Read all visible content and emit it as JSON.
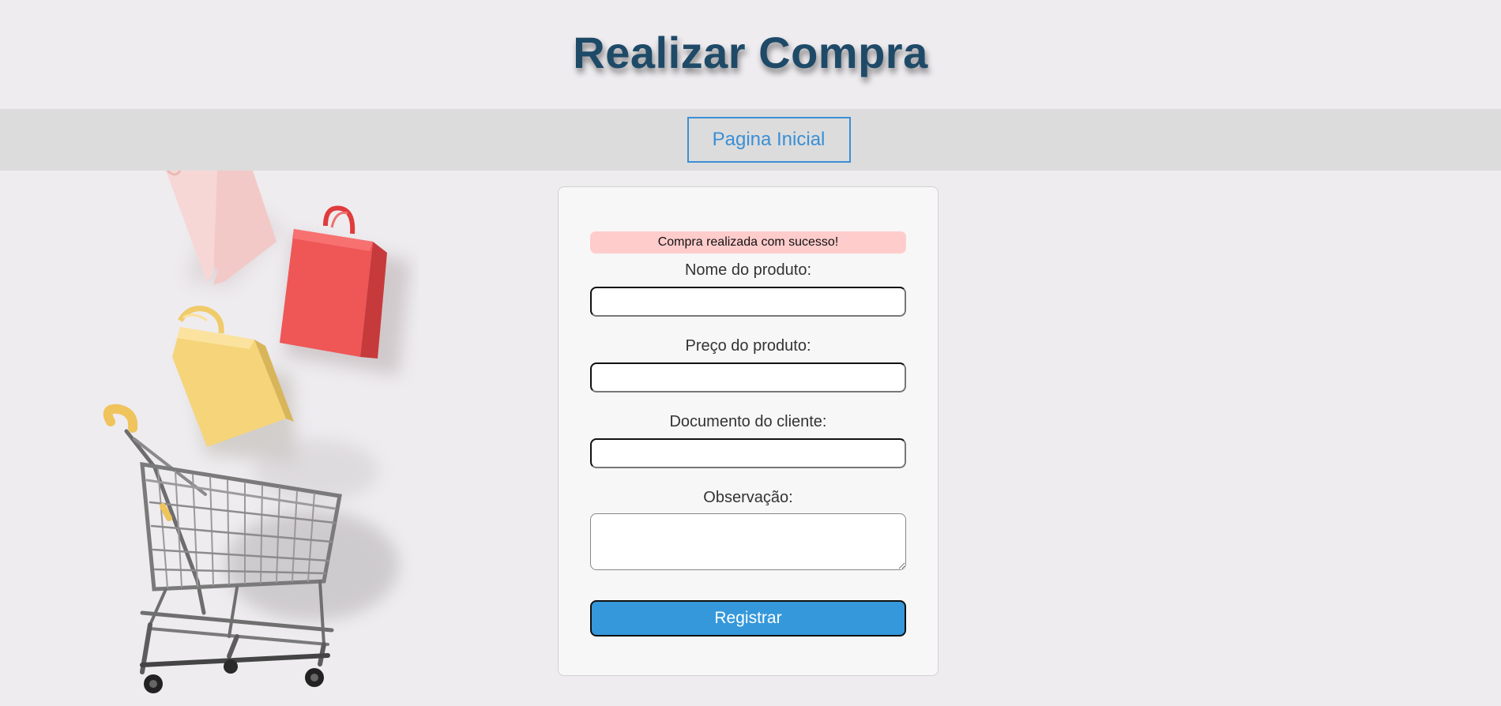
{
  "header": {
    "title": "Realizar Compra"
  },
  "nav": {
    "home_label": "Pagina Inicial"
  },
  "form": {
    "alert": "Compra realizada com sucesso!",
    "fields": [
      {
        "label": "Nome do produto:",
        "value": ""
      },
      {
        "label": "Preço do produto:",
        "value": ""
      },
      {
        "label": "Documento do cliente:",
        "value": ""
      }
    ],
    "notes": {
      "label": "Observação:",
      "value": ""
    },
    "submit_label": "Registrar"
  },
  "colors": {
    "title": "#1e4a68",
    "accent": "#3498db",
    "alert_bg": "#ffcccc",
    "nav_bg": "#dcdcdc"
  }
}
